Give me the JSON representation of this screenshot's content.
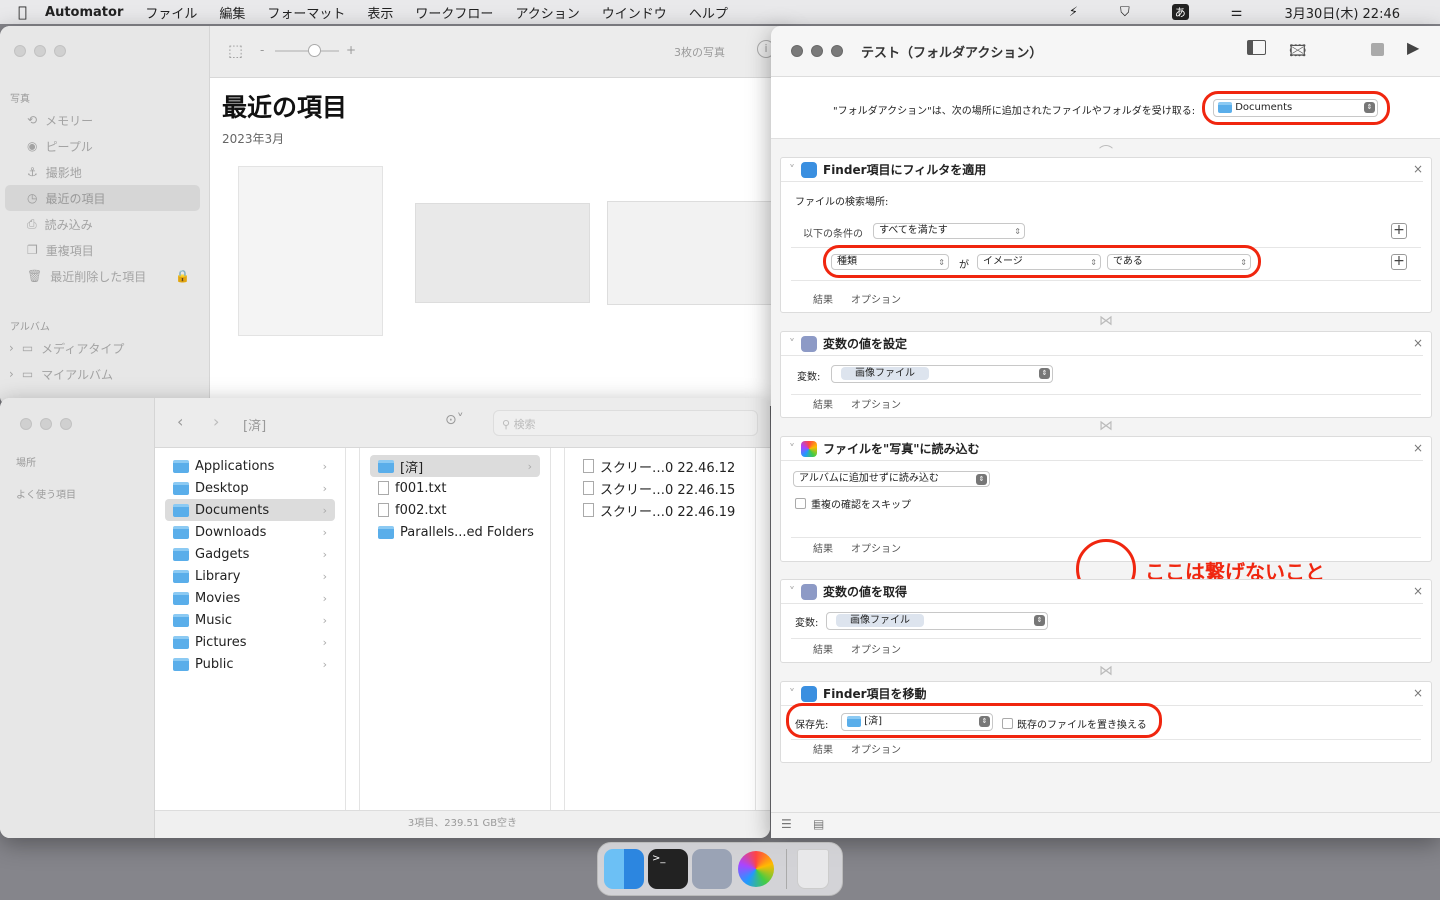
{
  "menubar": {
    "app": "Automator",
    "items": [
      "ファイル",
      "編集",
      "フォーマット",
      "表示",
      "ワークフロー",
      "アクション",
      "ウインドウ",
      "ヘルプ"
    ],
    "ime": "あ",
    "clock": "3月30日(木) 22:46"
  },
  "photos": {
    "sidebar_header_photos": "写真",
    "items": [
      "メモリー",
      "ピープル",
      "撮影地",
      "最近の項目",
      "読み込み",
      "重複項目",
      "最近削除した項目"
    ],
    "sidebar_header_albums": "アルバム",
    "albums": [
      "メディアタイプ",
      "マイアルバム"
    ],
    "zoom_minus": "-",
    "zoom_plus": "+",
    "count": "3枚の写真",
    "title": "最近の項目",
    "date": "2023年3月",
    "zoom_level": 0.6
  },
  "finder": {
    "path": "[済]",
    "search_placeholder": "検索",
    "sidebar_places": "場所",
    "sidebar_favorites": "よく使う項目",
    "col1": [
      "Applications",
      "Desktop",
      "Documents",
      "Downloads",
      "Gadgets",
      "Library",
      "Movies",
      "Music",
      "Pictures",
      "Public"
    ],
    "col2": [
      "[済]",
      "f001.txt",
      "f002.txt",
      "Parallels...ed Folders"
    ],
    "col3": [
      "スクリー…0 22.46.12",
      "スクリー…0 22.46.15",
      "スクリー…0 22.46.19"
    ],
    "status": "3項目、239.51 GB空き"
  },
  "automator": {
    "title": "テスト（フォルダアクション）",
    "receive_label": "\"フォルダアクション\"は、次の場所に追加されたファイルやフォルダを受け取る:",
    "receive_folder": "Documents",
    "footer_results": "結果",
    "footer_options": "オプション",
    "a1": {
      "title": "Finder項目にフィルタを適用",
      "search_label": "ファイルの検索場所:",
      "cond_label": "以下の条件の",
      "cond_value": "すべてを満たす",
      "field": "種類",
      "ga": "が",
      "kind": "イメージ",
      "op": "である"
    },
    "a2": {
      "title": "変数の値を設定",
      "var_label": "変数:",
      "var_value": "画像ファイル"
    },
    "a3": {
      "title": "ファイルを\"写真\"に読み込む",
      "mode": "アルバムに追加せずに読み込む",
      "skip_dup": "重複の確認をスキップ",
      "skip_dup_checked": false
    },
    "a4": {
      "title": "変数の値を取得",
      "var_label": "変数:",
      "var_value": "画像ファイル"
    },
    "a5": {
      "title": "Finder項目を移動",
      "dest_label": "保存先:",
      "dest_value": "[済]",
      "replace": "既存のファイルを置き換える",
      "replace_checked": false
    }
  },
  "annotation": {
    "text": "ここは繋げないこと",
    "color": "#f0260f"
  }
}
